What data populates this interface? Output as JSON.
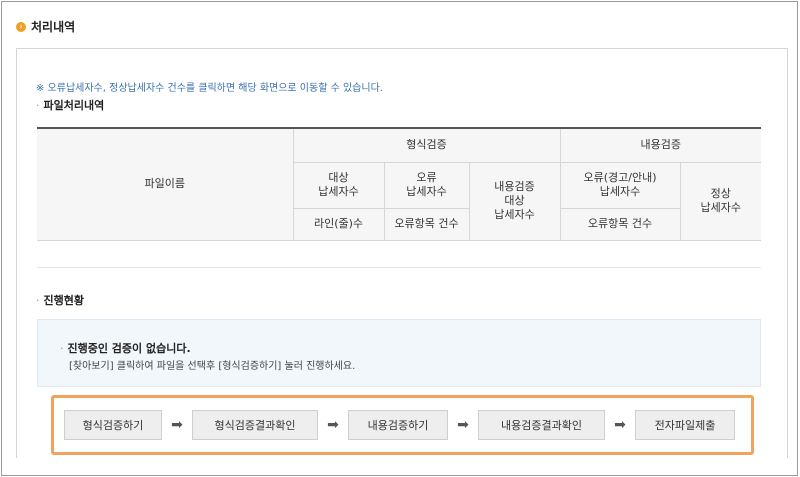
{
  "header": {
    "title": "처리내역"
  },
  "notice": "※ 오류납세자수, 정상납세자수 건수를 클릭하면 해당 화면으로 이동할 수 있습니다.",
  "file_section": {
    "title": "파일처리내역"
  },
  "table": {
    "col_filename": "파일이름",
    "group_format": "형식검증",
    "group_content": "내용검증",
    "target_taxpayers": "대상\n납세자수",
    "error_taxpayers": "오류\n납세자수",
    "content_target_taxpayers": "내용검증\n대상\n납세자수",
    "content_error_taxpayers": "오류(경고/안내)\n납세자수",
    "normal_taxpayers": "정상\n납세자수",
    "line_count": "라인(줄)수",
    "error_items_1": "오류항목 건수",
    "error_items_2": "오류항목 건수"
  },
  "progress_section": {
    "title": "진행현황"
  },
  "status": {
    "headline": "진행중인 검증이 없습니다.",
    "hint": "[찾아보기] 클릭하여 파일을 선택후 [형식검증하기] 눌러 진행하세요."
  },
  "steps": {
    "format_check": "형식검증하기",
    "format_result": "형식검증결과확인",
    "content_check": "내용검증하기",
    "content_result": "내용검증결과확인",
    "submit": "전자파일제출"
  },
  "icons": {
    "title_icon": "chevron-right-circle-icon",
    "step_arrow": "arrow-right-icon"
  },
  "colors": {
    "accent": "#f0a020",
    "step_border": "#f0a35c",
    "notice": "#3a6fb0"
  }
}
